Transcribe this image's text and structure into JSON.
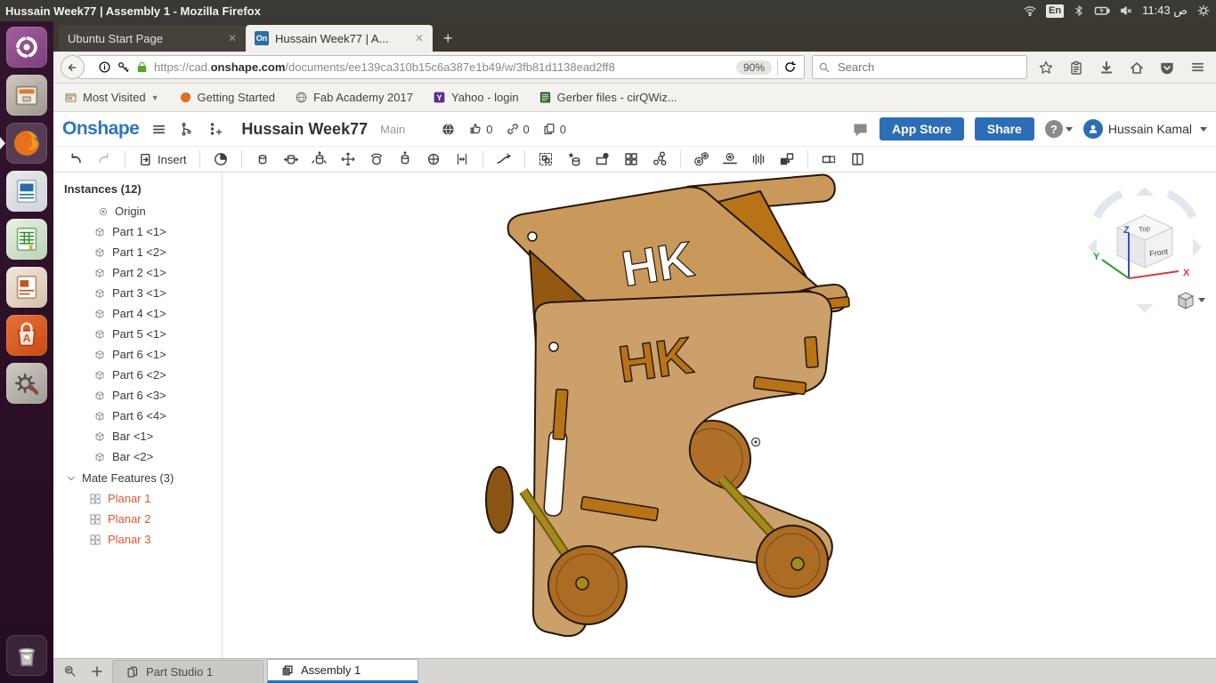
{
  "desktop": {
    "window_title": "Hussain Week77 | Assembly 1 - Mozilla Firefox",
    "keyboard_layout": "En",
    "time": "ص 11:43",
    "launcher_items": [
      "dash-home",
      "file-manager",
      "firefox",
      "libreoffice-writer",
      "libreoffice-calc",
      "libreoffice-impress",
      "ubuntu-software",
      "system-settings",
      "trash"
    ]
  },
  "browser": {
    "tabs": [
      {
        "title": "Ubuntu Start Page",
        "active": false
      },
      {
        "title": "Hussain Week77 | A...",
        "active": true,
        "favicon": "On"
      }
    ],
    "new_tab_label": "+",
    "url_pre": "https://cad.",
    "url_domain": "onshape.com",
    "url_path": "/documents/ee139ca310b15c6a387e1b49/w/3fb81d1138ead2ff8",
    "zoom_level": "90%",
    "search_placeholder": "Search",
    "bookmarks": [
      {
        "label": "Most Visited",
        "icon": "folder",
        "dropdown": true
      },
      {
        "label": "Getting Started",
        "icon": "firefox"
      },
      {
        "label": "Fab Academy 2017",
        "icon": "globe"
      },
      {
        "label": "Yahoo - login",
        "icon": "yahoo"
      },
      {
        "label": "Gerber files - cirQWiz...",
        "icon": "gerber"
      }
    ]
  },
  "onshape": {
    "logo": "Onshape",
    "document_title": "Hussain Week77",
    "workspace": "Main",
    "like_count": "0",
    "link_count": "0",
    "fork_count": "0",
    "comment_icon": "comment-bubble",
    "app_store_label": "App Store",
    "share_label": "Share",
    "help_label": "?",
    "user_name": "Hussain Kamal",
    "insert_label": "Insert",
    "toolbar_icon_names": [
      "undo",
      "redo",
      "insert",
      "mate",
      "fastened-mate",
      "revolute-mate",
      "slider-mate",
      "planar-mate",
      "ball-mate",
      "cylindrical-mate",
      "pin-slot-mate",
      "parallel-mate",
      "tangent-mate",
      "group",
      "make-part",
      "edit-in-context",
      "linear-pattern",
      "exploded-view",
      "gear-relation",
      "rack-pinion-relation",
      "screw-relation",
      "replicate",
      "section-view",
      "named-views"
    ],
    "disabled_toolbar_icons": [
      "redo"
    ],
    "instances": {
      "header": "Instances (12)",
      "origin_label": "Origin",
      "items": [
        "Part 1 <1>",
        "Part 1 <2>",
        "Part 2 <1>",
        "Part 3 <1>",
        "Part 4 <1>",
        "Part 5 <1>",
        "Part 6 <1>",
        "Part 6 <2>",
        "Part 6 <3>",
        "Part 6 <4>",
        "Bar <1>",
        "Bar <2>"
      ]
    },
    "mate_features": {
      "header": "Mate Features (3)",
      "items": [
        "Planar 1",
        "Planar 2",
        "Planar 3"
      ],
      "item_color": "#E2552F"
    },
    "bottom_tabs": [
      {
        "label": "Part Studio 1",
        "active": false
      },
      {
        "label": "Assembly 1",
        "active": true
      }
    ],
    "viewcube": {
      "top_label": "Top",
      "front_label": "Front",
      "axis_x": "X",
      "axis_y": "Y",
      "axis_z": "Z",
      "axis_colors": {
        "x": "#D83B3B",
        "y": "#2F9E2F",
        "z": "#3B4BD8"
      }
    },
    "model": {
      "description": "Wooden toy walker cart assembly with HK letter cutouts, slots, dowel axles and round wheels",
      "engraving": "HK",
      "colors": {
        "panel": "#C9995C",
        "panel_front": "#CBA06A",
        "side_orange": "#B87317",
        "interior_dark": "#935812",
        "floor": "#BD7A22",
        "wheel": "#AD6C24",
        "wheel_back": "#B06F28",
        "axle": "#A38A1D",
        "outline": "#241708"
      }
    }
  }
}
